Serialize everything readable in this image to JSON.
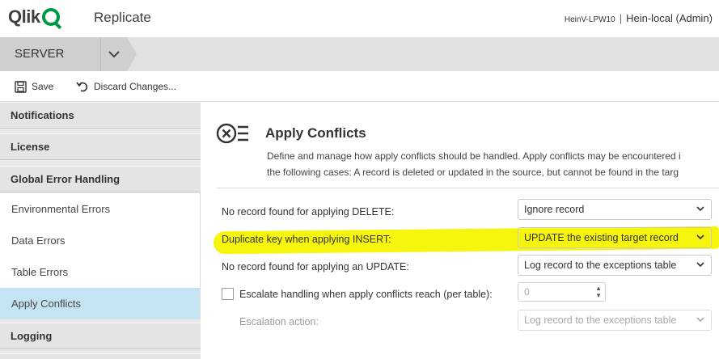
{
  "header": {
    "brand": "Qlik",
    "app_title": "Replicate",
    "host": "HeinV-LPW10",
    "separator": "|",
    "user": "Hein-local (Admin)"
  },
  "server_bar": {
    "label": "SERVER"
  },
  "toolbar": {
    "save_label": "Save",
    "discard_label": "Discard Changes..."
  },
  "sidebar": {
    "sections": [
      {
        "label": "Notifications"
      },
      {
        "label": "License"
      },
      {
        "label": "Global Error Handling"
      }
    ],
    "items": [
      {
        "label": "Environmental Errors"
      },
      {
        "label": "Data Errors"
      },
      {
        "label": "Table Errors"
      },
      {
        "label": "Apply Conflicts",
        "active": true
      }
    ],
    "footer_section": {
      "label": "Logging"
    }
  },
  "main": {
    "title": "Apply Conflicts",
    "description_line1": "Define and manage how apply conflicts should be handled. Apply conflicts may be encountered i",
    "description_line2": "the following cases: A record is deleted or updated in the source, but cannot be found in the targ",
    "rows": [
      {
        "label": "No record found for applying DELETE:",
        "value": "Ignore record"
      },
      {
        "label": "Duplicate key when applying INSERT:",
        "value": "UPDATE the existing target record"
      },
      {
        "label": "No record found for applying an UPDATE:",
        "value": "Log record to the exceptions table"
      }
    ],
    "escalation": {
      "checkbox_label": "Escalate handling when apply conflicts reach (per table):",
      "checked": false,
      "count_value": "0",
      "action_label": "Escalation action:",
      "action_value": "Log record to the exceptions table"
    }
  },
  "colors": {
    "brand_green": "#009845",
    "active_item": "#c5e4f3",
    "highlight": "#f6f400"
  }
}
